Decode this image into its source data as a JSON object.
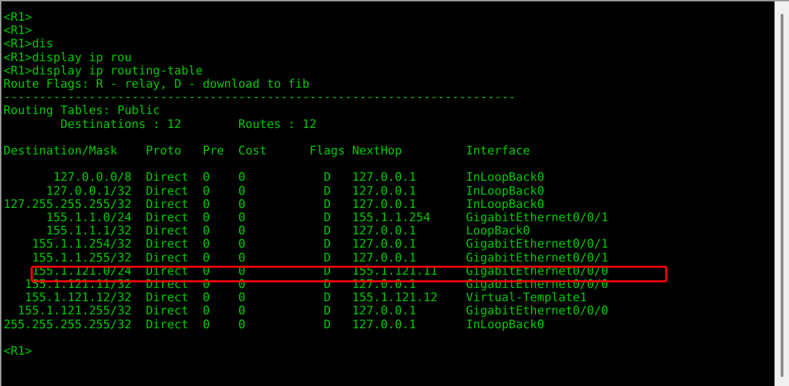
{
  "window": {
    "type": "terminal-console",
    "background_color": "#000000",
    "text_color": "#00c800",
    "highlight_color": "#ff0000",
    "scrollbar_track_color": "#f0f0f0",
    "scrollbar_thumb_color": "#8c8c8c"
  },
  "session": {
    "prompt": "<R1>",
    "device_name": "R1",
    "command_history": [
      "<R1>",
      "<R1>",
      "<R1>dis",
      "<R1>display ip rou",
      "<R1>display ip routing-table"
    ],
    "command_executed": "display ip routing-table"
  },
  "output": {
    "route_flags_line": "Route Flags: R - relay, D - download to fib",
    "separator": "------------------------------------------------------------------------------",
    "routing_tables_label": "Routing Tables: Public",
    "summary_line": "        Destinations : 12        Routes : 12",
    "destinations_label": "Destinations",
    "destinations_count": "12",
    "routes_label": "Routes",
    "routes_count": "12",
    "trailing_prompt": "<R1>"
  },
  "table": {
    "headers": [
      "Destination/Mask",
      "Proto",
      "Pre",
      "Cost",
      "Flags",
      "NextHop",
      "Interface"
    ],
    "header_line": "Destination/Mask    Proto   Pre  Cost      Flags NextHop         Interface",
    "rows": [
      {
        "destination": "127.0.0.0/8",
        "proto": "Direct",
        "pre": "0",
        "cost": "0",
        "flags": "D",
        "nexthop": "127.0.0.1",
        "interface": "InLoopBack0",
        "highlighted": false
      },
      {
        "destination": "127.0.0.1/32",
        "proto": "Direct",
        "pre": "0",
        "cost": "0",
        "flags": "D",
        "nexthop": "127.0.0.1",
        "interface": "InLoopBack0",
        "highlighted": false
      },
      {
        "destination": "127.255.255.255/32",
        "proto": "Direct",
        "pre": "0",
        "cost": "0",
        "flags": "D",
        "nexthop": "127.0.0.1",
        "interface": "InLoopBack0",
        "highlighted": false
      },
      {
        "destination": "155.1.1.0/24",
        "proto": "Direct",
        "pre": "0",
        "cost": "0",
        "flags": "D",
        "nexthop": "155.1.1.254",
        "interface": "GigabitEthernet0/0/1",
        "highlighted": false
      },
      {
        "destination": "155.1.1.1/32",
        "proto": "Direct",
        "pre": "0",
        "cost": "0",
        "flags": "D",
        "nexthop": "127.0.0.1",
        "interface": "LoopBack0",
        "highlighted": false
      },
      {
        "destination": "155.1.1.254/32",
        "proto": "Direct",
        "pre": "0",
        "cost": "0",
        "flags": "D",
        "nexthop": "127.0.0.1",
        "interface": "GigabitEthernet0/0/1",
        "highlighted": false
      },
      {
        "destination": "155.1.1.255/32",
        "proto": "Direct",
        "pre": "0",
        "cost": "0",
        "flags": "D",
        "nexthop": "127.0.0.1",
        "interface": "GigabitEthernet0/0/1",
        "highlighted": false
      },
      {
        "destination": "155.1.121.0/24",
        "proto": "Direct",
        "pre": "0",
        "cost": "0",
        "flags": "D",
        "nexthop": "155.1.121.11",
        "interface": "GigabitEthernet0/0/0",
        "highlighted": true
      },
      {
        "destination": "155.1.121.11/32",
        "proto": "Direct",
        "pre": "0",
        "cost": "0",
        "flags": "D",
        "nexthop": "127.0.0.1",
        "interface": "GigabitEthernet0/0/0",
        "highlighted": false
      },
      {
        "destination": "155.1.121.12/32",
        "proto": "Direct",
        "pre": "0",
        "cost": "0",
        "flags": "D",
        "nexthop": "155.1.121.12",
        "interface": "Virtual-Template1",
        "highlighted": false
      },
      {
        "destination": "155.1.121.255/32",
        "proto": "Direct",
        "pre": "0",
        "cost": "0",
        "flags": "D",
        "nexthop": "127.0.0.1",
        "interface": "GigabitEthernet0/0/0",
        "highlighted": false
      },
      {
        "destination": "255.255.255.255/32",
        "proto": "Direct",
        "pre": "0",
        "cost": "0",
        "flags": "D",
        "nexthop": "127.0.0.1",
        "interface": "InLoopBack0",
        "highlighted": false
      }
    ]
  },
  "console_text": "<R1>\n<R1>\n<R1>dis\n<R1>display ip rou\n<R1>display ip routing-table\nRoute Flags: R - relay, D - download to fib\n------------------------------------------------------------------------\nRouting Tables: Public\n        Destinations : 12        Routes : 12\n\nDestination/Mask    Proto   Pre  Cost      Flags NextHop         Interface\n\n       127.0.0.0/8  Direct  0    0           D   127.0.0.1       InLoopBack0\n      127.0.0.1/32  Direct  0    0           D   127.0.0.1       InLoopBack0\n127.255.255.255/32  Direct  0    0           D   127.0.0.1       InLoopBack0\n      155.1.1.0/24  Direct  0    0           D   155.1.1.254     GigabitEthernet0/0/1\n      155.1.1.1/32  Direct  0    0           D   127.0.0.1       LoopBack0\n    155.1.1.254/32  Direct  0    0           D   127.0.0.1       GigabitEthernet0/0/1\n    155.1.1.255/32  Direct  0    0           D   127.0.0.1       GigabitEthernet0/0/1\n    155.1.121.0/24  Direct  0    0           D   155.1.121.11    GigabitEthernet0/0/0\n   155.1.121.11/32  Direct  0    0           D   127.0.0.1       GigabitEthernet0/0/0\n   155.1.121.12/32  Direct  0    0           D   155.1.121.12    Virtual-Template1\n  155.1.121.255/32  Direct  0    0           D   127.0.0.1       GigabitEthernet0/0/0\n255.255.255.255/32  Direct  0    0           D   127.0.0.1       InLoopBack0\n\n<R1>",
  "annotation": {
    "type": "red-rectangle-highlight",
    "target_row": "155.1.121.0/24",
    "color": "#ff0000"
  },
  "scrollbar": {
    "orientation": "vertical",
    "position": "right"
  }
}
